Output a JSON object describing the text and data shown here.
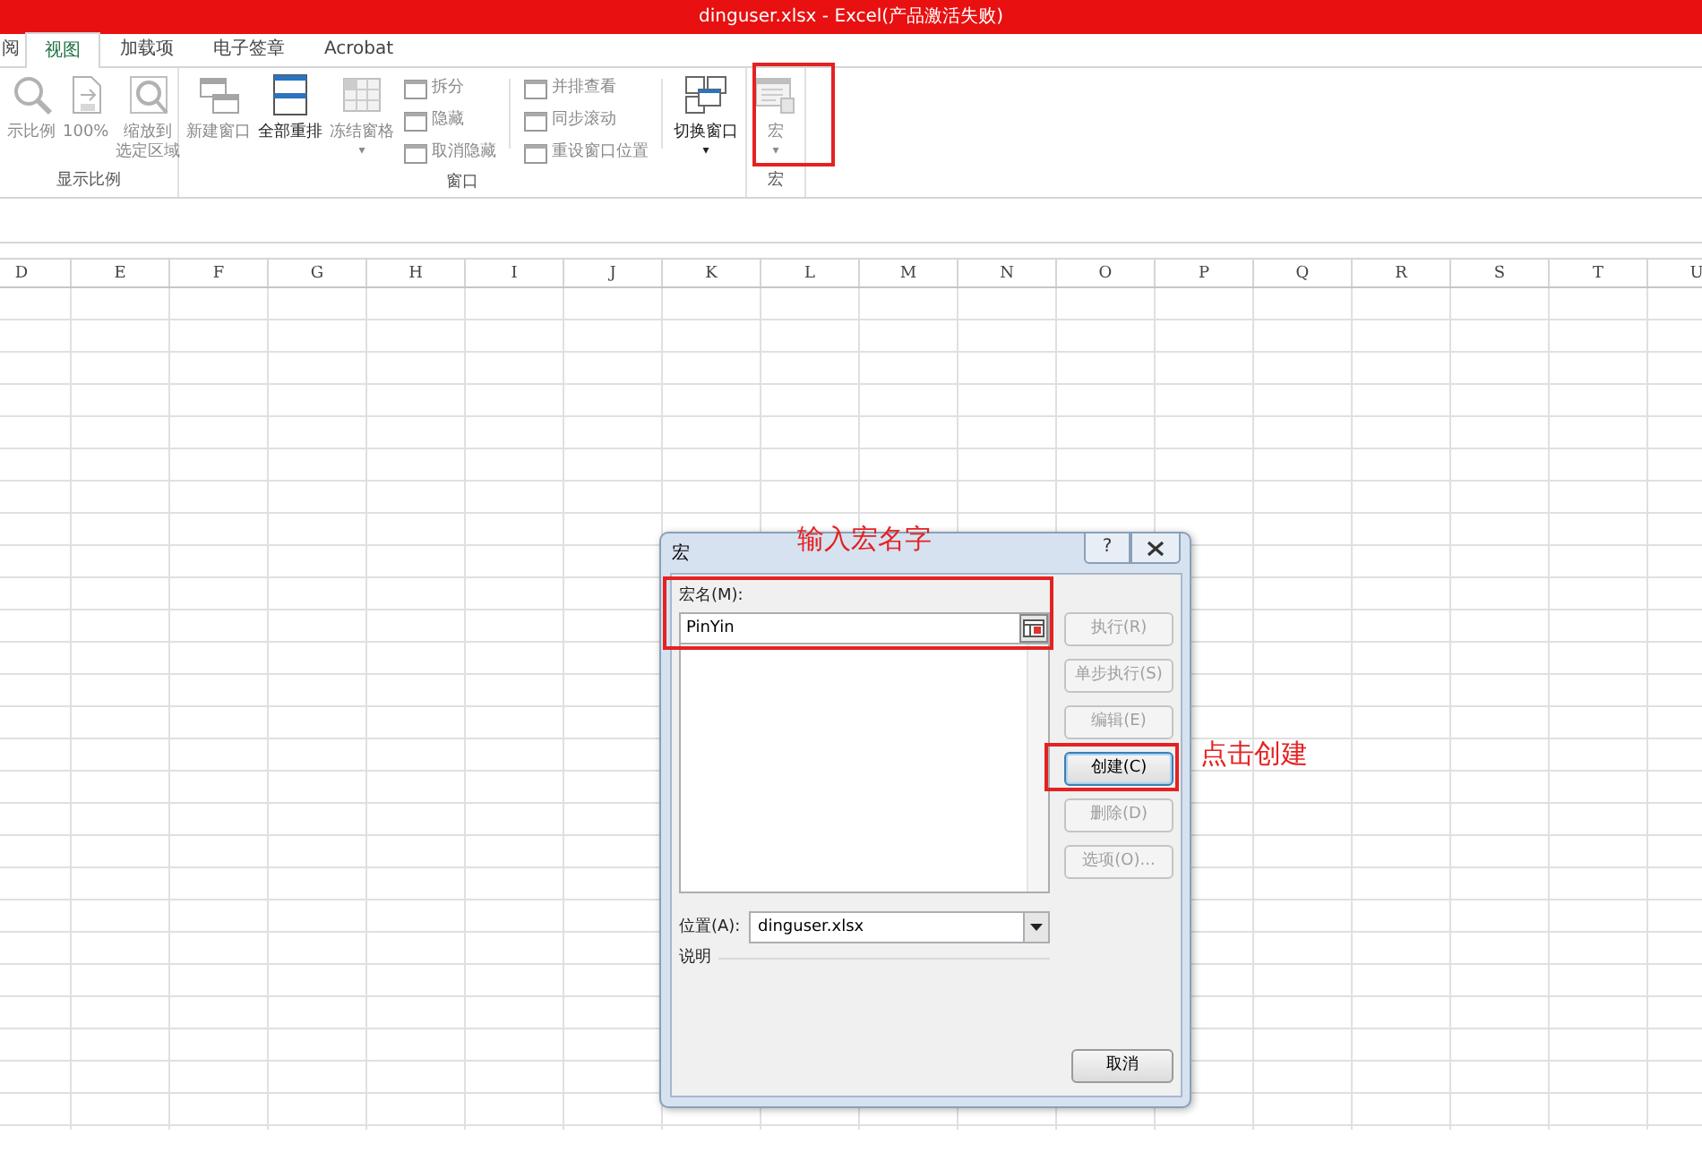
{
  "title_bar": {
    "title": "dinguser.xlsx -  Excel(产品激活失败)"
  },
  "tabs": [
    {
      "label": "阅",
      "selected": false
    },
    {
      "label": "视图",
      "selected": true
    },
    {
      "label": "加载项",
      "selected": false
    },
    {
      "label": "电子签章",
      "selected": false
    },
    {
      "label": "Acrobat",
      "selected": false
    }
  ],
  "ribbon_groups": [
    {
      "label": "显示比例",
      "items": [
        {
          "kind": "large",
          "label": "示比例",
          "disabled": true
        },
        {
          "kind": "large",
          "label": "100%",
          "disabled": true
        },
        {
          "kind": "large",
          "label": "缩放到",
          "label_2": "选定区域",
          "disabled": true
        }
      ]
    },
    {
      "label": "窗口",
      "items": [
        {
          "kind": "large",
          "label": "新建窗口",
          "disabled": true
        },
        {
          "kind": "large",
          "label": "全部重排",
          "disabled": false
        },
        {
          "kind": "large",
          "label": "冻结窗格",
          "disabled": true,
          "menu": "▾"
        },
        {
          "kind": "stack",
          "buttons": [
            {
              "label": "拆分",
              "disabled": true
            },
            {
              "label": "隐藏",
              "disabled": true
            },
            {
              "label": "取消隐藏",
              "disabled": true
            }
          ]
        },
        {
          "kind": "divider"
        },
        {
          "kind": "stack",
          "buttons": [
            {
              "label": "并排查看",
              "disabled": true
            },
            {
              "label": "同步滚动",
              "disabled": true
            },
            {
              "label": "重设窗口位置",
              "disabled": true
            }
          ]
        },
        {
          "kind": "divider"
        },
        {
          "kind": "large",
          "label": "切换窗口",
          "disabled": false,
          "menu": "▾"
        }
      ]
    },
    {
      "label": "宏",
      "items": [
        {
          "kind": "large",
          "label": "宏",
          "disabled": true,
          "menu": "▾"
        }
      ]
    }
  ],
  "columns": [
    "D",
    "E",
    "F",
    "G",
    "H",
    "I",
    "J",
    "K",
    "L",
    "M",
    "N",
    "O",
    "P",
    "Q",
    "R",
    "S",
    "T",
    "U"
  ],
  "dialog": {
    "title": "宏",
    "help": "?",
    "name_label": "宏名(M):",
    "name_value": "PinYin",
    "location_label": "位置(A):",
    "location_value": "dinguser.xlsx",
    "description_label": "说明",
    "buttons": [
      {
        "label": "执行(R)",
        "disabled": true,
        "default": false
      },
      {
        "label": "单步执行(S)",
        "disabled": true,
        "default": false
      },
      {
        "label": "编辑(E)",
        "disabled": true,
        "default": false
      },
      {
        "label": "创建(C)",
        "disabled": false,
        "default": true
      },
      {
        "label": "删除(D)",
        "disabled": true,
        "default": false
      },
      {
        "label": "选项(O)...",
        "disabled": true,
        "default": false
      }
    ],
    "cancel": "取消"
  },
  "annotations": [
    {
      "text": "输入宏名字"
    },
    {
      "text": "点击创建"
    }
  ]
}
